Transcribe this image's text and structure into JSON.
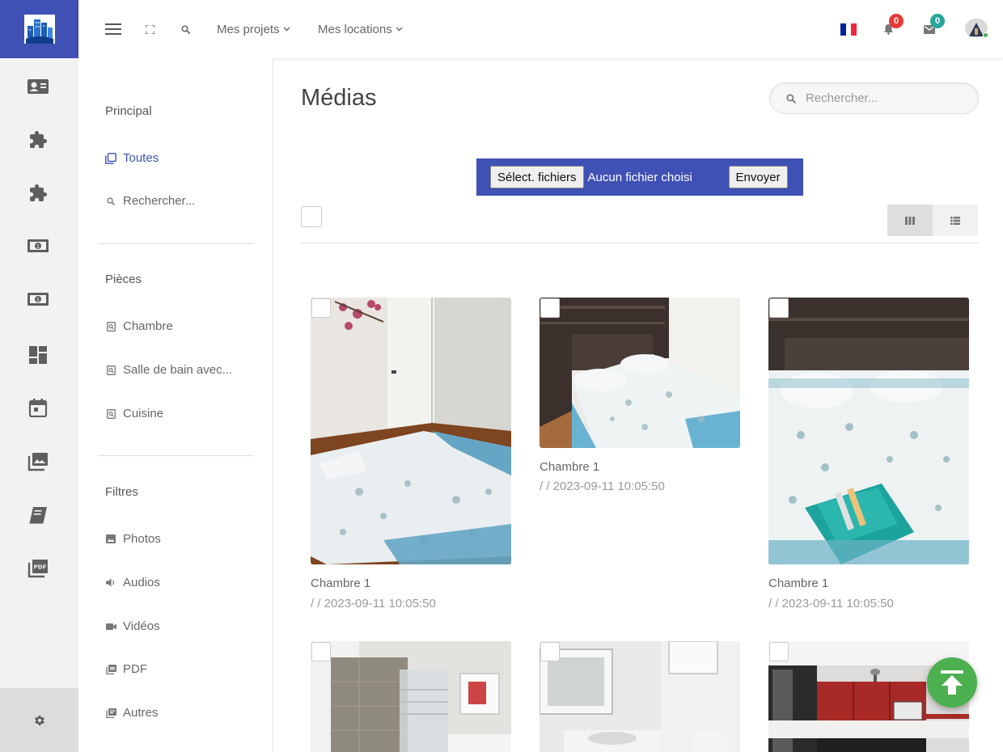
{
  "topbar": {
    "menu_icon": "hamburger-icon",
    "fullscreen_icon": "fullscreen-icon",
    "search_icon": "search-icon",
    "menus": [
      {
        "label": "Mes projets"
      },
      {
        "label": "Mes locations"
      }
    ],
    "language_flag": "flag-fr-icon",
    "notifications_count": "0",
    "messages_count": "0",
    "notification_badge_color": "#e53935",
    "message_badge_color": "#26a69a"
  },
  "rail": {
    "accent_color": "#3f51b5",
    "icons": [
      "contact-card-icon",
      "puzzle-icon",
      "puzzle-icon",
      "money-icon",
      "money-icon",
      "dashboard-icon",
      "calendar-icon",
      "photo-library-icon",
      "book-icon",
      "pdf-icon"
    ],
    "settings_icon": "gear-icon"
  },
  "sidebar": {
    "sections": [
      {
        "heading": "Principal",
        "items": [
          {
            "label": "Toutes",
            "icon": "copy-icon"
          },
          {
            "label": "Rechercher...",
            "icon": "search-icon"
          }
        ]
      },
      {
        "heading": "Pièces",
        "items": [
          {
            "label": "Chambre",
            "icon": "room-icon"
          },
          {
            "label": "Salle de bain avec...",
            "icon": "room-icon"
          },
          {
            "label": "Cuisine",
            "icon": "room-icon"
          }
        ]
      },
      {
        "heading": "Filtres",
        "items": [
          {
            "label": "Photos",
            "icon": "image-icon"
          },
          {
            "label": "Audios",
            "icon": "audio-icon"
          },
          {
            "label": "Vidéos",
            "icon": "video-icon"
          },
          {
            "label": "PDF",
            "icon": "pdf-icon"
          },
          {
            "label": "Autres",
            "icon": "other-icon"
          }
        ]
      }
    ]
  },
  "main": {
    "title": "Médias",
    "search_placeholder": "Rechercher...",
    "upload": {
      "select_label": "Sélect. fichiers",
      "status": "Aucun fichier choisi",
      "send_label": "Envoyer"
    },
    "view_modes": [
      "grid-icon",
      "list-icon"
    ],
    "cards": [
      {
        "title": "Chambre 1",
        "meta": "/ / 2023-09-11 10:05:50"
      },
      {
        "title": "Chambre 1",
        "meta": "/ / 2023-09-11 10:05:50"
      },
      {
        "title": "Chambre 1",
        "meta": "/ / 2023-09-11 10:05:50"
      }
    ]
  },
  "fab": {
    "icon": "scroll-to-top-icon",
    "color": "#4caf50"
  }
}
